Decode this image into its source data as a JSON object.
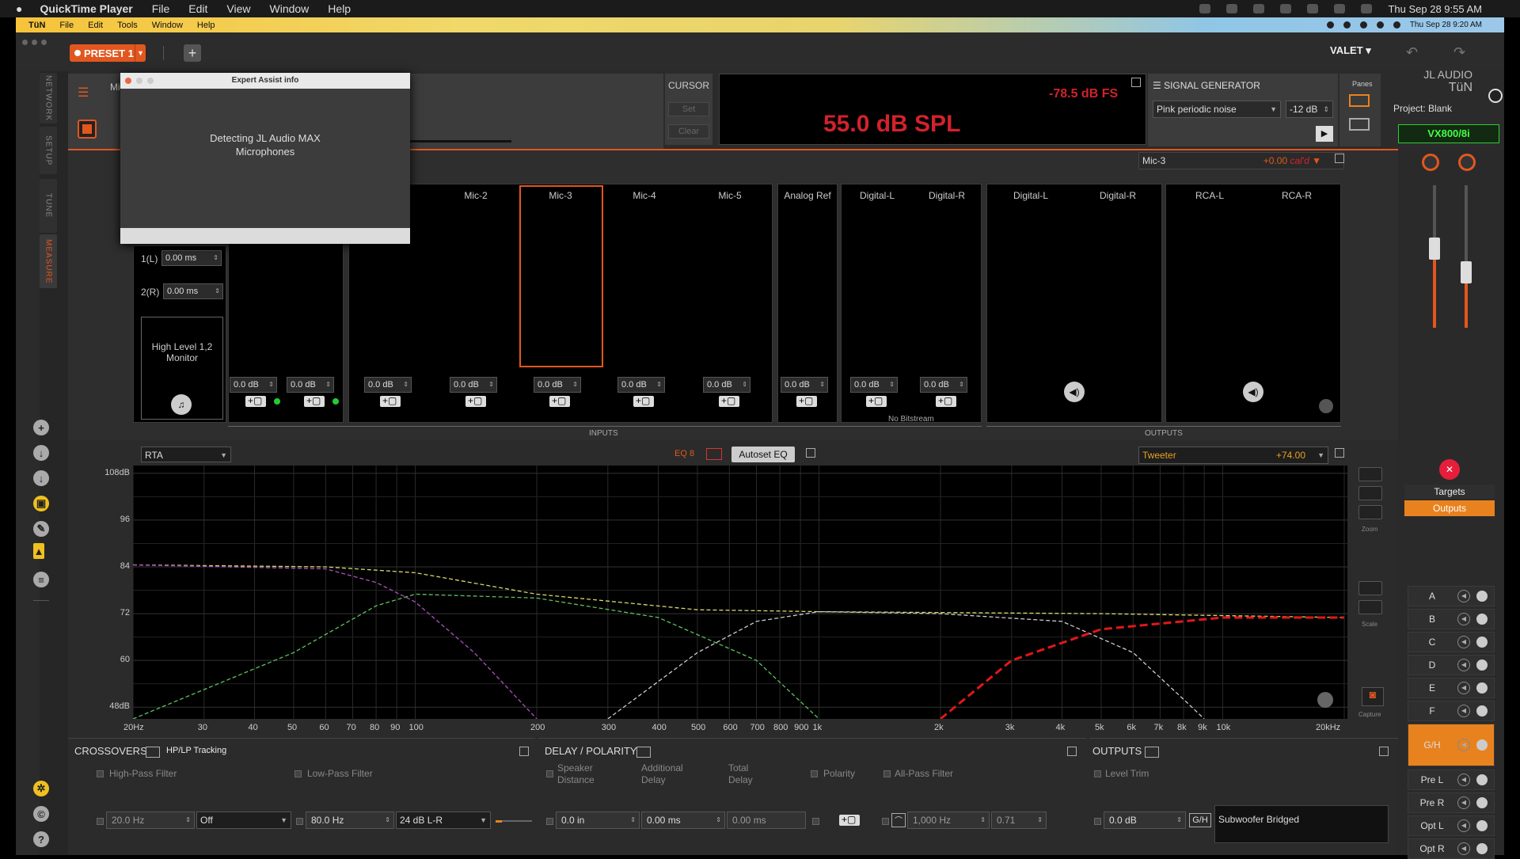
{
  "mac_menu": {
    "app": "QuickTime Player",
    "items": [
      "File",
      "Edit",
      "View",
      "Window",
      "Help"
    ],
    "datetime": "Thu Sep 28  9:55 AM"
  },
  "inner_menu": {
    "app": "TüN",
    "items": [
      "File",
      "Edit",
      "Tools",
      "Window",
      "Help"
    ],
    "datetime": "Thu Sep 28  9:20 AM"
  },
  "toolbar": {
    "preset": "PRESET 1",
    "valet": "VALET"
  },
  "rail": {
    "tabs": [
      "NETWORK",
      "SETUP",
      "TUNE",
      "MEASURE"
    ],
    "active": "MEASURE"
  },
  "header": {
    "partial_label": "Mi",
    "cursor_title": "CURSOR",
    "set": "Set",
    "clear": "Clear"
  },
  "meter": {
    "dbfs": "-78.5 dB FS",
    "spl": "55.0 dB SPL"
  },
  "signal_generator": {
    "title": "SIGNAL GENERATOR",
    "noise": "Pink periodic noise",
    "level": "-12 dB",
    "panes_label": "Panes"
  },
  "brand": {
    "logo_line1": "JL AUDIO",
    "logo_line2": "TüN",
    "project": "Project: Blank",
    "device": "VX800/8i"
  },
  "dialog": {
    "title": "Expert Assist info",
    "message_line1": "Detecting JL Audio MAX",
    "message_line2": "Microphones"
  },
  "inputs": {
    "delays": [
      {
        "label": "1(L)",
        "value": "0.00 ms"
      },
      {
        "label": "2(R)",
        "value": "0.00 ms"
      }
    ],
    "monitor": "High Level 1,2\nMonitor",
    "mics": [
      "Mic-2",
      "Mic-3",
      "Mic-4",
      "Mic-5"
    ],
    "analog_ref": "Analog Ref",
    "digital": [
      "Digital-L",
      "Digital-R"
    ],
    "gain": "0.0 dB",
    "no_bitstream": "No Bitstream",
    "section": "INPUTS"
  },
  "outputs_io": {
    "digital": [
      "Digital-L",
      "Digital-R"
    ],
    "rca": [
      "RCA-L",
      "RCA-R"
    ],
    "section": "OUTPUTS"
  },
  "mic_select": {
    "name": "Mic-3",
    "value": "+0.00",
    "cal": "cal'd"
  },
  "graph": {
    "mode": "RTA",
    "eq": "EQ 8",
    "autoeq": "Autoset EQ",
    "channel": "Tweeter",
    "channel_value": "+74.00",
    "y_ticks": [
      "108dB",
      "96",
      "84",
      "72",
      "60",
      "48dB"
    ],
    "x_ticks": [
      "20Hz",
      "30",
      "40",
      "50",
      "60",
      "70",
      "80",
      "90",
      "100",
      "200",
      "300",
      "400",
      "500",
      "600",
      "700",
      "800",
      "900",
      "1k",
      "2k",
      "3k",
      "4k",
      "5k",
      "6k",
      "7k",
      "8k",
      "9k",
      "10k",
      "20kHz"
    ],
    "zoom": "Zoom",
    "scale": "Scale",
    "capture": "Capture"
  },
  "right_panel": {
    "targets": "Targets",
    "outputs": "Outputs",
    "channels": [
      "A",
      "B",
      "C",
      "D",
      "E",
      "F",
      "G/H",
      "Pre L",
      "Pre R",
      "Opt L",
      "Opt R"
    ],
    "active_channel": "G/H"
  },
  "crossovers": {
    "title": "CROSSOVERS",
    "tracking": "HP/LP Tracking",
    "hp": "High-Pass Filter",
    "lp": "Low-Pass Filter",
    "hp_freq": "20.0 Hz",
    "hp_slope": "Off",
    "lp_freq": "80.0 Hz",
    "lp_slope": "24 dB L-R"
  },
  "delay": {
    "title": "DELAY / POLARITY",
    "speaker_distance": "Speaker\nDistance",
    "additional_delay": "Additional\nDelay",
    "total_delay": "Total\nDelay",
    "polarity": "Polarity",
    "allpass": "All-Pass Filter",
    "distance": "0.0 in",
    "additional": "0.00 ms",
    "total": "0.00 ms",
    "ap_freq": "1,000 Hz",
    "ap_q": "0.71"
  },
  "outputs_panel": {
    "title": "OUTPUTS",
    "level_trim": "Level Trim",
    "trim": "0.0 dB",
    "gh": "G/H",
    "bridged": "Subwoofer Bridged"
  },
  "chart_data": {
    "type": "line",
    "ylabel": "",
    "ylim": [
      45,
      110
    ],
    "x_scale": "log",
    "xlim": [
      20,
      20000
    ],
    "grid": true,
    "series": [
      {
        "color": "#d8d870",
        "x": [
          20,
          60,
          100,
          200,
          500,
          1000,
          5000,
          20000
        ],
        "y": [
          84.5,
          84,
          82.5,
          77,
          73,
          72.5,
          72,
          71
        ]
      },
      {
        "color": "#b050c0",
        "x": [
          20,
          60,
          80,
          100,
          140,
          200
        ],
        "y": [
          84.5,
          83.5,
          80,
          75,
          62,
          45
        ]
      },
      {
        "color": "#60c060",
        "x": [
          20,
          50,
          80,
          100,
          200,
          400,
          700,
          1000
        ],
        "y": [
          45,
          62,
          74,
          77,
          76,
          71,
          60,
          45
        ]
      },
      {
        "color": "#cccccc",
        "x": [
          300,
          500,
          700,
          1000,
          2000,
          4000,
          6000,
          8000,
          9000
        ],
        "y": [
          45,
          62,
          70,
          72.5,
          72,
          70,
          62,
          50,
          45
        ]
      },
      {
        "color": "#e01818",
        "x": [
          2000,
          3000,
          5000,
          10000,
          20000
        ],
        "y": [
          45,
          60,
          68,
          71,
          71
        ]
      }
    ]
  }
}
